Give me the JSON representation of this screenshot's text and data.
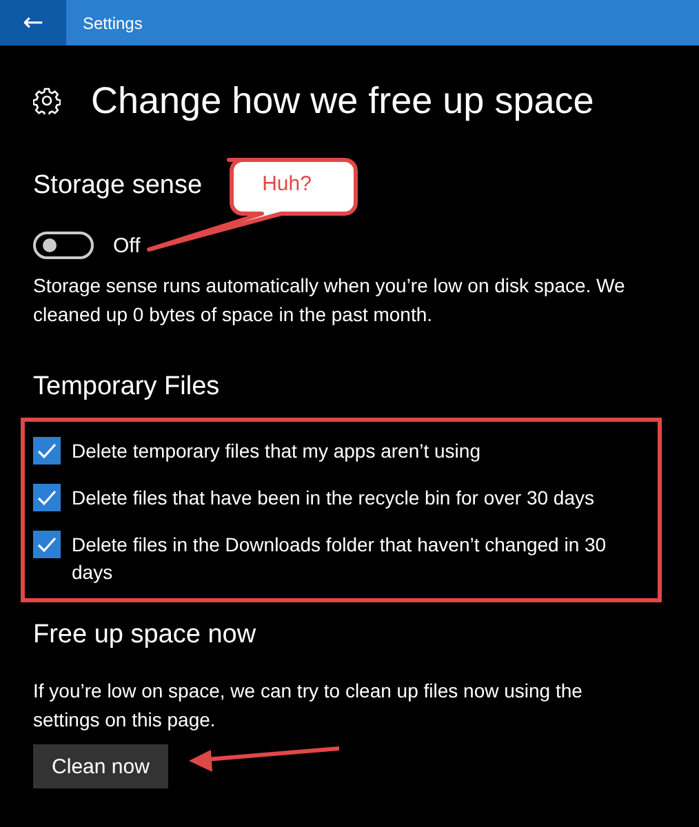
{
  "window": {
    "title": "Settings",
    "back": "←"
  },
  "page": {
    "title": "Change how we free up space"
  },
  "storage_sense": {
    "heading": "Storage sense",
    "toggle": {
      "on": false,
      "label": "Off"
    },
    "description": "Storage sense runs automatically when you’re low on disk space. We cleaned up 0 bytes of space in the past month."
  },
  "temporary_files": {
    "heading": "Temporary Files",
    "options": [
      {
        "label": "Delete temporary files that my apps aren’t using",
        "checked": true
      },
      {
        "label": "Delete files that have been in the recycle bin for over 30 days",
        "checked": true
      },
      {
        "label": "Delete files in the Downloads folder that haven’t changed in 30 days",
        "checked": true
      }
    ]
  },
  "free_up_space": {
    "heading": "Free up space now",
    "description": "If you’re low on space, we can try to clean up files now using the settings on this page.",
    "button": "Clean now"
  },
  "annotations": {
    "callout": "Huh?"
  }
}
